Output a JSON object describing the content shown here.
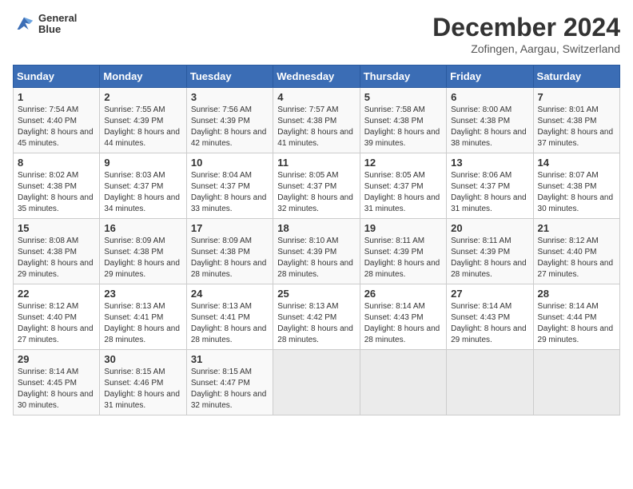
{
  "header": {
    "logo_line1": "General",
    "logo_line2": "Blue",
    "month": "December 2024",
    "location": "Zofingen, Aargau, Switzerland"
  },
  "weekdays": [
    "Sunday",
    "Monday",
    "Tuesday",
    "Wednesday",
    "Thursday",
    "Friday",
    "Saturday"
  ],
  "weeks": [
    [
      {
        "day": "1",
        "info": "Sunrise: 7:54 AM\nSunset: 4:40 PM\nDaylight: 8 hours and 45 minutes."
      },
      {
        "day": "2",
        "info": "Sunrise: 7:55 AM\nSunset: 4:39 PM\nDaylight: 8 hours and 44 minutes."
      },
      {
        "day": "3",
        "info": "Sunrise: 7:56 AM\nSunset: 4:39 PM\nDaylight: 8 hours and 42 minutes."
      },
      {
        "day": "4",
        "info": "Sunrise: 7:57 AM\nSunset: 4:38 PM\nDaylight: 8 hours and 41 minutes."
      },
      {
        "day": "5",
        "info": "Sunrise: 7:58 AM\nSunset: 4:38 PM\nDaylight: 8 hours and 39 minutes."
      },
      {
        "day": "6",
        "info": "Sunrise: 8:00 AM\nSunset: 4:38 PM\nDaylight: 8 hours and 38 minutes."
      },
      {
        "day": "7",
        "info": "Sunrise: 8:01 AM\nSunset: 4:38 PM\nDaylight: 8 hours and 37 minutes."
      }
    ],
    [
      {
        "day": "8",
        "info": "Sunrise: 8:02 AM\nSunset: 4:38 PM\nDaylight: 8 hours and 35 minutes."
      },
      {
        "day": "9",
        "info": "Sunrise: 8:03 AM\nSunset: 4:37 PM\nDaylight: 8 hours and 34 minutes."
      },
      {
        "day": "10",
        "info": "Sunrise: 8:04 AM\nSunset: 4:37 PM\nDaylight: 8 hours and 33 minutes."
      },
      {
        "day": "11",
        "info": "Sunrise: 8:05 AM\nSunset: 4:37 PM\nDaylight: 8 hours and 32 minutes."
      },
      {
        "day": "12",
        "info": "Sunrise: 8:05 AM\nSunset: 4:37 PM\nDaylight: 8 hours and 31 minutes."
      },
      {
        "day": "13",
        "info": "Sunrise: 8:06 AM\nSunset: 4:37 PM\nDaylight: 8 hours and 31 minutes."
      },
      {
        "day": "14",
        "info": "Sunrise: 8:07 AM\nSunset: 4:38 PM\nDaylight: 8 hours and 30 minutes."
      }
    ],
    [
      {
        "day": "15",
        "info": "Sunrise: 8:08 AM\nSunset: 4:38 PM\nDaylight: 8 hours and 29 minutes."
      },
      {
        "day": "16",
        "info": "Sunrise: 8:09 AM\nSunset: 4:38 PM\nDaylight: 8 hours and 29 minutes."
      },
      {
        "day": "17",
        "info": "Sunrise: 8:09 AM\nSunset: 4:38 PM\nDaylight: 8 hours and 28 minutes."
      },
      {
        "day": "18",
        "info": "Sunrise: 8:10 AM\nSunset: 4:39 PM\nDaylight: 8 hours and 28 minutes."
      },
      {
        "day": "19",
        "info": "Sunrise: 8:11 AM\nSunset: 4:39 PM\nDaylight: 8 hours and 28 minutes."
      },
      {
        "day": "20",
        "info": "Sunrise: 8:11 AM\nSunset: 4:39 PM\nDaylight: 8 hours and 28 minutes."
      },
      {
        "day": "21",
        "info": "Sunrise: 8:12 AM\nSunset: 4:40 PM\nDaylight: 8 hours and 27 minutes."
      }
    ],
    [
      {
        "day": "22",
        "info": "Sunrise: 8:12 AM\nSunset: 4:40 PM\nDaylight: 8 hours and 27 minutes."
      },
      {
        "day": "23",
        "info": "Sunrise: 8:13 AM\nSunset: 4:41 PM\nDaylight: 8 hours and 28 minutes."
      },
      {
        "day": "24",
        "info": "Sunrise: 8:13 AM\nSunset: 4:41 PM\nDaylight: 8 hours and 28 minutes."
      },
      {
        "day": "25",
        "info": "Sunrise: 8:13 AM\nSunset: 4:42 PM\nDaylight: 8 hours and 28 minutes."
      },
      {
        "day": "26",
        "info": "Sunrise: 8:14 AM\nSunset: 4:43 PM\nDaylight: 8 hours and 28 minutes."
      },
      {
        "day": "27",
        "info": "Sunrise: 8:14 AM\nSunset: 4:43 PM\nDaylight: 8 hours and 29 minutes."
      },
      {
        "day": "28",
        "info": "Sunrise: 8:14 AM\nSunset: 4:44 PM\nDaylight: 8 hours and 29 minutes."
      }
    ],
    [
      {
        "day": "29",
        "info": "Sunrise: 8:14 AM\nSunset: 4:45 PM\nDaylight: 8 hours and 30 minutes."
      },
      {
        "day": "30",
        "info": "Sunrise: 8:15 AM\nSunset: 4:46 PM\nDaylight: 8 hours and 31 minutes."
      },
      {
        "day": "31",
        "info": "Sunrise: 8:15 AM\nSunset: 4:47 PM\nDaylight: 8 hours and 32 minutes."
      },
      {
        "day": "",
        "info": ""
      },
      {
        "day": "",
        "info": ""
      },
      {
        "day": "",
        "info": ""
      },
      {
        "day": "",
        "info": ""
      }
    ]
  ]
}
